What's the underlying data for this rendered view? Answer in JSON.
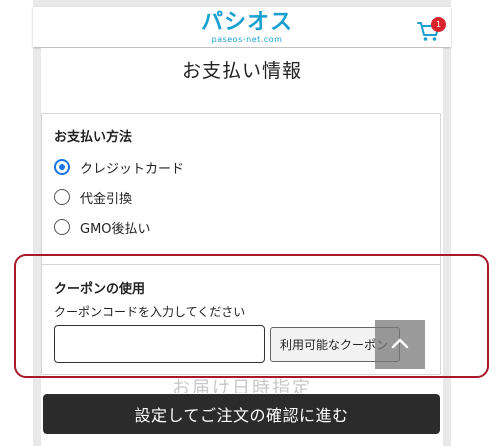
{
  "header": {
    "logo_text": "パシオス",
    "logo_subtext": "paseos-net.com",
    "cart_count": "1"
  },
  "page": {
    "title": "お支払い情報"
  },
  "payment": {
    "heading": "お支払い方法",
    "options": [
      {
        "label": "クレジットカード",
        "selected": true
      },
      {
        "label": "代金引換",
        "selected": false
      },
      {
        "label": "GMO後払い",
        "selected": false
      }
    ]
  },
  "coupon": {
    "heading": "クーポンの使用",
    "description": "クーポンコードを入力してください",
    "input_value": "",
    "available_button_label": "利用可能なクーポン"
  },
  "next_section": {
    "partial_heading": "お届け日時指定"
  },
  "footer": {
    "confirm_button_label": "設定してご注文の確認に進む"
  },
  "colors": {
    "brand": "#19a0d0",
    "selected_radio": "#1a73e8",
    "highlight_outline": "#a8182a",
    "cart_badge": "#d9232d",
    "confirm_button_bg": "#2b2b2b"
  }
}
